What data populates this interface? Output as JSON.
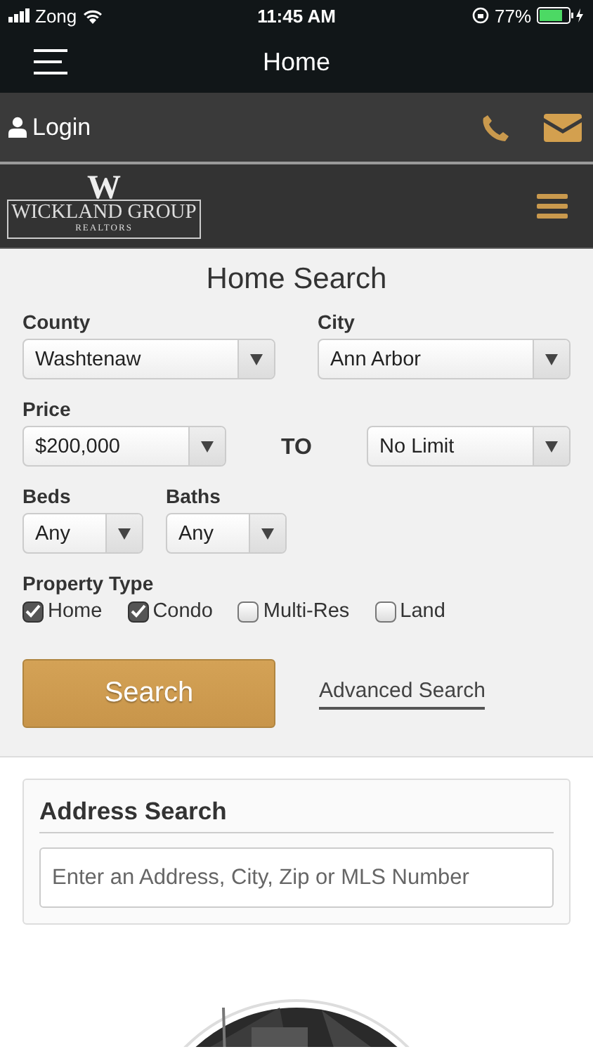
{
  "status_bar": {
    "carrier": "Zong",
    "time": "11:45 AM",
    "battery": "77%"
  },
  "nav_bar": {
    "title": "Home"
  },
  "top_bar": {
    "login": "Login"
  },
  "logo": {
    "mark": "W",
    "name": "WICKLAND GROUP",
    "tagline": "REALTORS"
  },
  "home_search": {
    "title": "Home Search",
    "county": {
      "label": "County",
      "value": "Washtenaw"
    },
    "city": {
      "label": "City",
      "value": "Ann Arbor"
    },
    "price": {
      "label": "Price",
      "min": "$200,000",
      "to": "TO",
      "max": "No Limit"
    },
    "beds": {
      "label": "Beds",
      "value": "Any"
    },
    "baths": {
      "label": "Baths",
      "value": "Any"
    },
    "property_type": {
      "label": "Property Type",
      "options": [
        {
          "label": "Home",
          "checked": true
        },
        {
          "label": "Condo",
          "checked": true
        },
        {
          "label": "Multi-Res",
          "checked": false
        },
        {
          "label": "Land",
          "checked": false
        }
      ]
    },
    "search_button": "Search",
    "advanced_link": "Advanced Search"
  },
  "address_search": {
    "title": "Address Search",
    "placeholder": "Enter an Address, City, Zip or MLS Number"
  }
}
